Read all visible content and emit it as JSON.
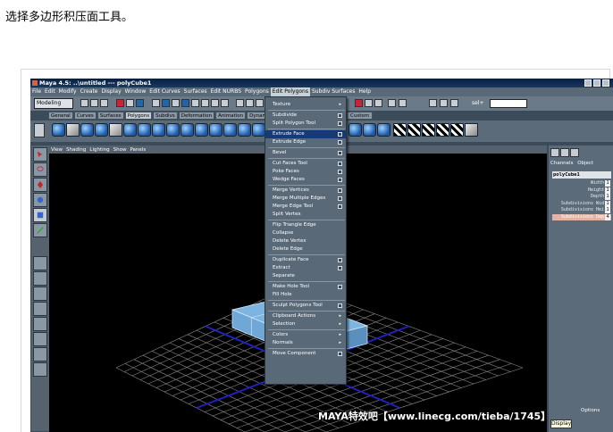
{
  "caption": "选择多边形积压面工具。",
  "window": {
    "title": "Maya 4.5: ..\\untitled  ---  polyCube1"
  },
  "menubar": [
    "File",
    "Edit",
    "Modify",
    "Create",
    "Display",
    "Window",
    "Edit Curves",
    "Surfaces",
    "Edit NURBS",
    "Polygons",
    "Edit Polygons",
    "Subdiv Surfaces",
    "Help"
  ],
  "menubar_active": "Edit Polygons",
  "statusline": {
    "mode": "Modeling",
    "sel_label": "sel+"
  },
  "shelf_tabs": [
    "General",
    "Curves",
    "Surfaces",
    "Polygons",
    "Subdivs",
    "Deformation",
    "Animation",
    "Dynamics",
    "Rendering"
  ],
  "shelf_tab_active": "Polygons",
  "shelf_tab_custom": "Custom",
  "viewport_menu": [
    "View",
    "Shading",
    "Lighting",
    "Show",
    "Panels"
  ],
  "edit_polygons_menu": [
    {
      "label": "Texture",
      "submenu": true
    },
    {
      "sep": true
    },
    {
      "label": "Subdivide",
      "option": true
    },
    {
      "label": "Split Polygon Tool",
      "option": true
    },
    {
      "sep": true
    },
    {
      "label": "Extrude Face",
      "option": true,
      "selected": true
    },
    {
      "label": "Extrude Edge",
      "option": true
    },
    {
      "sep": true
    },
    {
      "label": "Bevel",
      "option": true
    },
    {
      "sep": true
    },
    {
      "label": "Cut Faces Tool",
      "option": true
    },
    {
      "label": "Poke Faces",
      "option": true
    },
    {
      "label": "Wedge Faces",
      "option": true
    },
    {
      "sep": true
    },
    {
      "label": "Merge Vertices",
      "option": true
    },
    {
      "label": "Merge Multiple Edges",
      "option": true
    },
    {
      "label": "Merge Edge Tool",
      "option": true
    },
    {
      "label": "Split Vertex"
    },
    {
      "sep": true
    },
    {
      "label": "Flip Triangle Edge"
    },
    {
      "label": "Collapse"
    },
    {
      "label": "Delete Vertex"
    },
    {
      "label": "Delete Edge"
    },
    {
      "sep": true
    },
    {
      "label": "Duplicate Face",
      "option": true
    },
    {
      "label": "Extract",
      "option": true
    },
    {
      "label": "Separate"
    },
    {
      "sep": true
    },
    {
      "label": "Make Hole Tool",
      "option": true
    },
    {
      "label": "Fill Hole"
    },
    {
      "sep": true
    },
    {
      "label": "Sculpt Polygons Tool",
      "option": true
    },
    {
      "sep": true
    },
    {
      "label": "Clipboard Actions",
      "submenu": true
    },
    {
      "label": "Selection",
      "submenu": true
    },
    {
      "sep": true
    },
    {
      "label": "Colors",
      "submenu": true
    },
    {
      "label": "Normals",
      "submenu": true
    },
    {
      "sep": true
    },
    {
      "label": "Move Component",
      "option": true
    }
  ],
  "channel_box": {
    "tabs": [
      "Channels",
      "Object"
    ],
    "object_name": "polyCube1",
    "attributes": [
      {
        "name": "Width",
        "value": "1"
      },
      {
        "name": "Height",
        "value": "1"
      },
      {
        "name": "Depth",
        "value": "1"
      },
      {
        "name": "Subdivisions Wid",
        "value": "1"
      },
      {
        "name": "Subdivisions Hei",
        "value": "1"
      },
      {
        "name": "Subdivisions Dep",
        "value": "4",
        "highlighted": true
      }
    ],
    "options_label": "Options"
  },
  "tooltip": "Display",
  "watermark": "MAYA特效吧【www.linecg.com/tieba/1745】",
  "colors": {
    "maya_bg": "#3b4b5a",
    "menu_highlight": "#143a77",
    "mesh": "#6fa8d6",
    "axis": "#2020c0"
  }
}
